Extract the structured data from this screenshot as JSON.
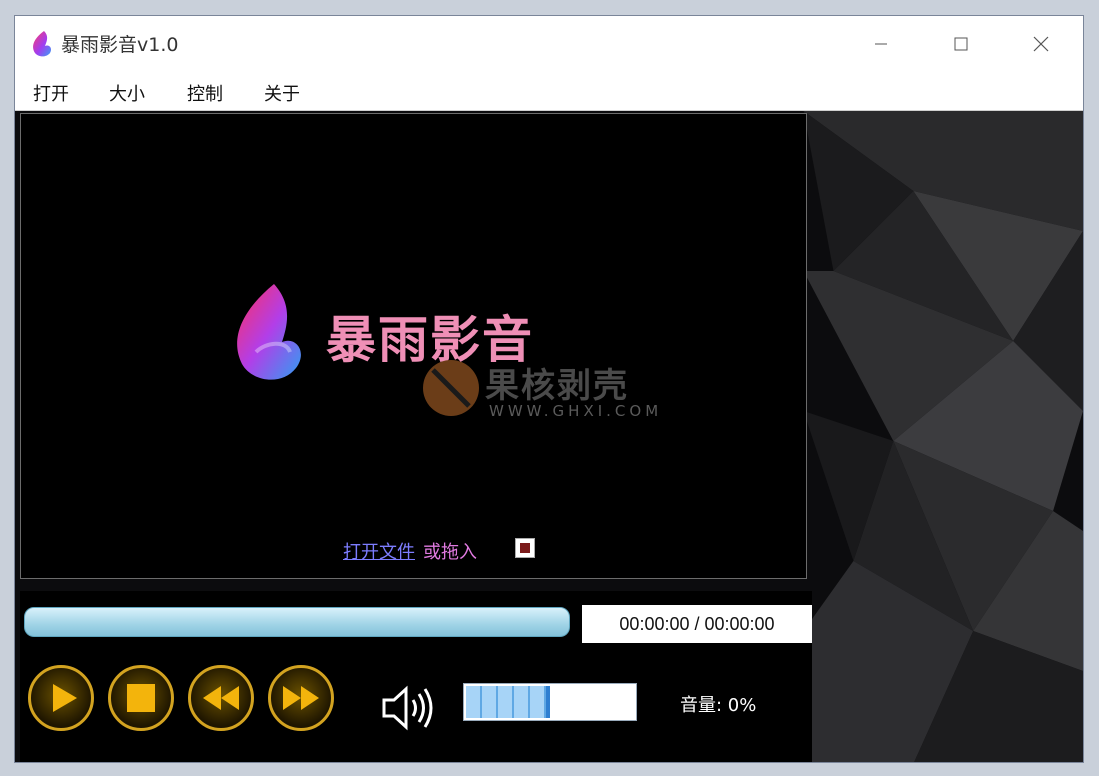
{
  "window": {
    "title": "暴雨影音v1.0",
    "controls": {
      "minimize": "minimize",
      "maximize": "maximize",
      "close": "close"
    }
  },
  "menu": [
    "打开",
    "大小",
    "控制",
    "关于"
  ],
  "video": {
    "logo_text": "暴雨影音",
    "watermark_cn": "果核剥壳",
    "watermark_en": "WWW.GHXI.COM",
    "open_link": "打开文件",
    "drag_text": "或拖入"
  },
  "playback": {
    "time": "00:00:00 / 00:00:00",
    "progress": 0
  },
  "buttons": {
    "play": "play-icon",
    "stop": "stop-icon",
    "rewind": "rewind-icon",
    "forward": "fast-forward-icon"
  },
  "volume": {
    "label": "音量: 0%",
    "level": 0.5
  },
  "colors": {
    "accent_gold": "#d3a320",
    "progress_blue": "#9fd3e6",
    "link": "#7d7dff",
    "drag_text": "#e07ae0",
    "logo_pink": "#ef8fb6"
  }
}
